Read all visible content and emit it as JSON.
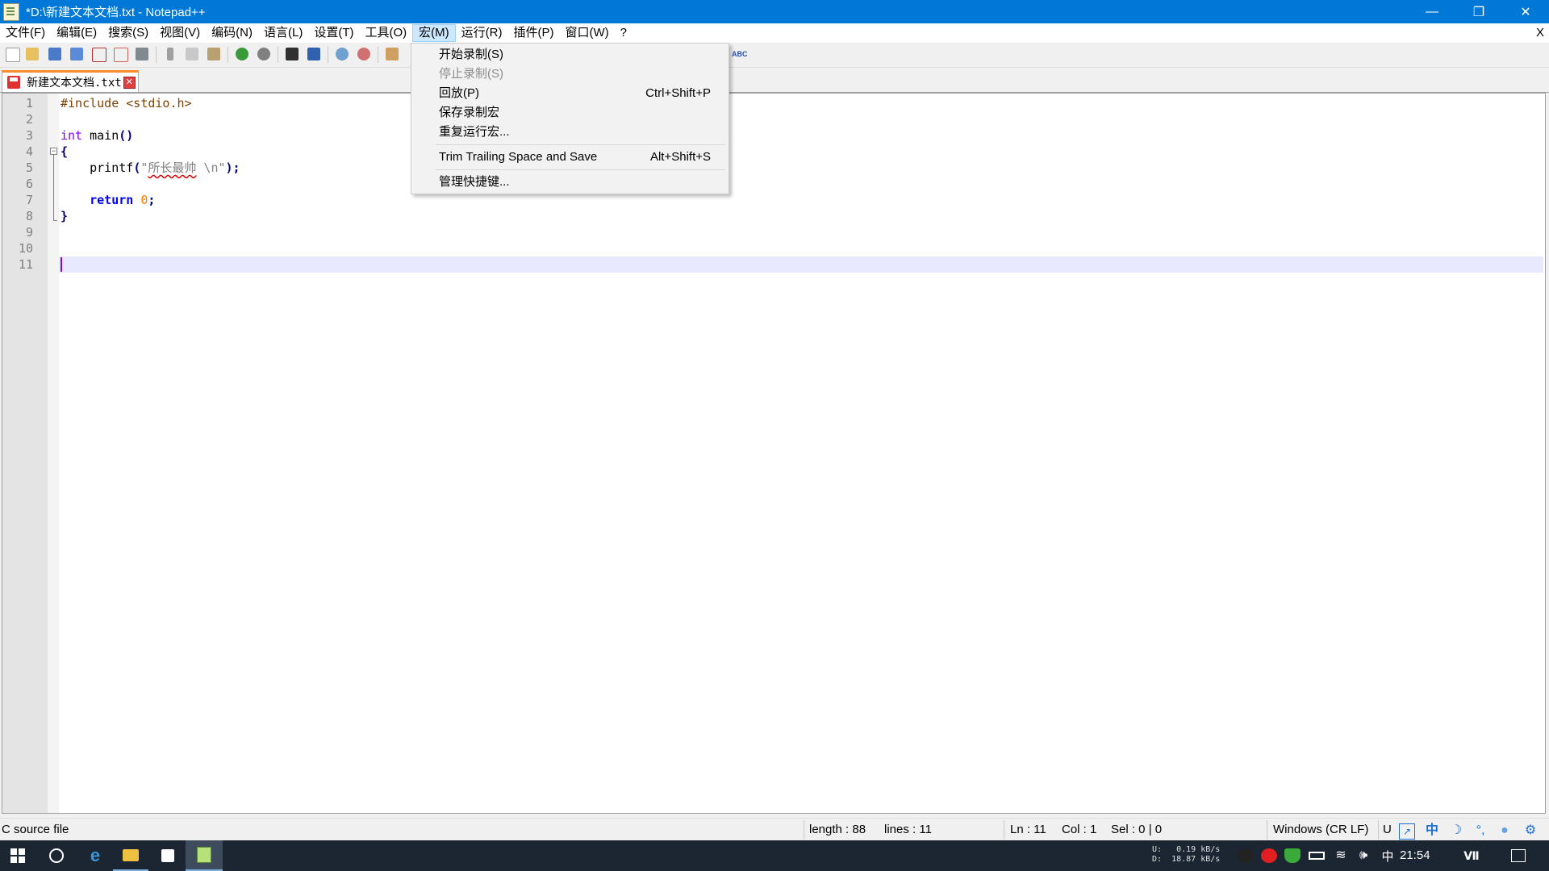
{
  "window": {
    "title": "*D:\\新建文本文档.txt - Notepad++",
    "controls": {
      "minimize": "—",
      "restore": "❐",
      "close": "✕"
    }
  },
  "menubar": {
    "items": [
      "文件(F)",
      "编辑(E)",
      "搜索(S)",
      "视图(V)",
      "编码(N)",
      "语言(L)",
      "设置(T)",
      "工具(O)",
      "宏(M)",
      "运行(R)",
      "插件(P)",
      "窗口(W)",
      "?"
    ],
    "active_index": 8,
    "close_doc": "X"
  },
  "tab": {
    "label": "新建文本文档.txt",
    "close": "✕"
  },
  "editor": {
    "line_numbers": [
      "1",
      "2",
      "3",
      "4",
      "5",
      "6",
      "7",
      "8",
      "9",
      "10",
      "11"
    ],
    "current_line": 11,
    "code": {
      "l1": "#include <stdio.h>",
      "l3_kw": "int",
      "l3_rest": " main",
      "l3_paren": "()",
      "l4": "{",
      "l5_fn": "    printf",
      "l5_paren_open": "(",
      "l5_quote_open": "\"",
      "l5_cn": "所长最帅",
      "l5_str_rest": " \\n\"",
      "l5_close": ");",
      "l7_kw": "    return",
      "l7_num": " 0",
      "l7_semi": ";",
      "l8": "}"
    }
  },
  "macro_menu": {
    "items": [
      {
        "label": "开始录制(S)",
        "shortcut": "",
        "disabled": false
      },
      {
        "label": "停止录制(S)",
        "shortcut": "",
        "disabled": true
      },
      {
        "label": "回放(P)",
        "shortcut": "Ctrl+Shift+P",
        "disabled": false
      },
      {
        "label": "保存录制宏",
        "shortcut": "",
        "disabled": false
      },
      {
        "label": "重复运行宏...",
        "shortcut": "",
        "disabled": false
      },
      {
        "label": "Trim Trailing Space and Save",
        "shortcut": "Alt+Shift+S",
        "disabled": false
      },
      {
        "label": "管理快捷键...",
        "shortcut": "",
        "disabled": false
      }
    ]
  },
  "statusbar": {
    "language": "C source file",
    "length": "length : 88",
    "lines": "lines : 11",
    "ln": "Ln : 11",
    "col": "Col : 1",
    "sel": "Sel : 0 | 0",
    "eol": "Windows (CR LF)",
    "encoding_partial": "U",
    "ime": "中"
  },
  "taskbar": {
    "net_up": "U:   0.19 kB/s",
    "net_down": "D:  18.87 kB/s",
    "ime": "中",
    "clock": "21:54"
  }
}
